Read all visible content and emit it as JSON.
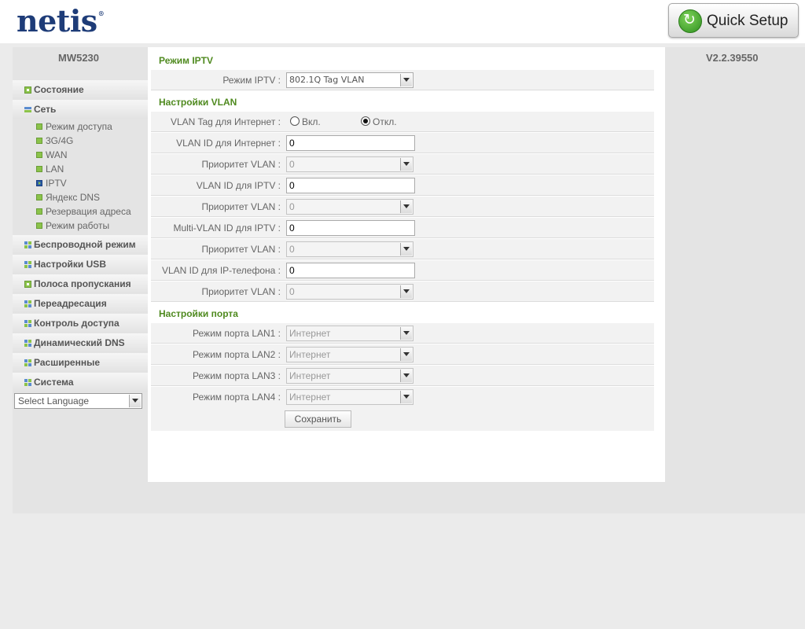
{
  "header": {
    "logo": "netis",
    "logo_reg": "®",
    "quick_setup": "Quick Setup"
  },
  "device": {
    "model": "MW5230",
    "firmware": "V2.2.39550"
  },
  "sidebar": {
    "items": [
      {
        "label": "Состояние"
      },
      {
        "label": "Сеть",
        "subitems": [
          {
            "label": "Режим доступа"
          },
          {
            "label": "3G/4G"
          },
          {
            "label": "WAN"
          },
          {
            "label": "LAN"
          },
          {
            "label": "IPTV"
          },
          {
            "label": "Яндекс DNS"
          },
          {
            "label": "Резервация адреса"
          },
          {
            "label": "Режим работы"
          }
        ]
      },
      {
        "label": "Беспроводной режим"
      },
      {
        "label": "Настройки USB"
      },
      {
        "label": "Полоса пропускания"
      },
      {
        "label": "Переадресация"
      },
      {
        "label": "Контроль доступа"
      },
      {
        "label": "Динамический DNS"
      },
      {
        "label": "Расширенные"
      },
      {
        "label": "Система"
      }
    ],
    "language": "Select Language"
  },
  "iptv": {
    "section_title": "Режим IPTV",
    "mode_label": "Режим IPTV :",
    "mode_value": "802.1Q Tag VLAN"
  },
  "vlan": {
    "section_title": "Настройки VLAN",
    "tag_label": "VLAN Tag для Интернет :",
    "tag_on": "Вкл.",
    "tag_off": "Откл.",
    "internet_id_label": "VLAN ID для Интернет :",
    "internet_id_value": "0",
    "prio1_label": "Приоритет VLAN :",
    "prio1_value": "0",
    "iptv_id_label": "VLAN ID для IPTV :",
    "iptv_id_value": "0",
    "prio2_label": "Приоритет VLAN :",
    "prio2_value": "0",
    "multi_id_label": "Multi-VLAN ID для IPTV :",
    "multi_id_value": "0",
    "prio3_label": "Приоритет VLAN :",
    "prio3_value": "0",
    "phone_id_label": "VLAN ID для IP-телефона :",
    "phone_id_value": "0",
    "prio4_label": "Приоритет VLAN :",
    "prio4_value": "0"
  },
  "ports": {
    "section_title": "Настройки порта",
    "lan1_label": "Режим порта LAN1 :",
    "lan1_value": "Интернет",
    "lan2_label": "Режим порта LAN2 :",
    "lan2_value": "Интернет",
    "lan3_label": "Режим порта LAN3 :",
    "lan3_value": "Интернет",
    "lan4_label": "Режим порта LAN4 :",
    "lan4_value": "Интернет"
  },
  "save_label": "Сохранить"
}
